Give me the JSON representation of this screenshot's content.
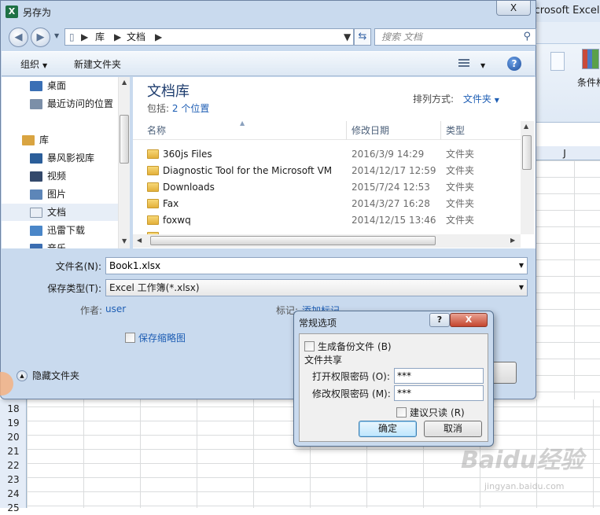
{
  "excel": {
    "title_fragment": "icrosoft Excel",
    "ribbon_label": "条件格",
    "column_header": "J",
    "row_numbers": [
      "18",
      "19",
      "20",
      "21",
      "22",
      "23",
      "24",
      "25"
    ]
  },
  "save_dialog": {
    "title": "另存为",
    "close_label": "X",
    "breadcrumb": [
      "库",
      "文档"
    ],
    "search_placeholder": "搜索 文档",
    "toolbar": {
      "organize": "组织",
      "new_folder": "新建文件夹"
    },
    "nav_items": [
      {
        "label": "桌面",
        "icon": "desktop-icon"
      },
      {
        "label": "最近访问的位置",
        "icon": "recent-places-icon"
      },
      {
        "label": "库",
        "icon": "libraries-icon"
      },
      {
        "label": "暴风影视库",
        "icon": "video-library-icon"
      },
      {
        "label": "视频",
        "icon": "video-icon"
      },
      {
        "label": "图片",
        "icon": "picture-icon"
      },
      {
        "label": "文档",
        "icon": "document-icon"
      },
      {
        "label": "迅雷下载",
        "icon": "download-icon"
      },
      {
        "label": "音乐",
        "icon": "music-icon"
      }
    ],
    "library": {
      "title": "文档库",
      "includes_prefix": "包括:",
      "includes_link": "2 个位置",
      "arrange_label": "排列方式:",
      "arrange_value": "文件夹"
    },
    "columns": {
      "name": "名称",
      "modified": "修改日期",
      "type": "类型"
    },
    "files": [
      {
        "name": "360js Files",
        "modified": "2016/3/9 14:29",
        "type": "文件夹"
      },
      {
        "name": "Diagnostic Tool for the Microsoft VM",
        "modified": "2014/12/17 12:59",
        "type": "文件夹"
      },
      {
        "name": "Downloads",
        "modified": "2015/7/24 12:53",
        "type": "文件夹"
      },
      {
        "name": "Fax",
        "modified": "2014/3/27 16:28",
        "type": "文件夹"
      },
      {
        "name": "foxwq",
        "modified": "2014/12/15 13:46",
        "type": "文件夹"
      }
    ],
    "form": {
      "filename_label": "文件名(N):",
      "filename_value": "Book1.xlsx",
      "filetype_label": "保存类型(T):",
      "filetype_value": "Excel 工作簿(*.xlsx)",
      "author_label": "作者:",
      "author_value": "user",
      "tags_label": "标记:",
      "tags_value": "添加标记",
      "thumbnail_label": "保存缩略图",
      "hide_folders": "隐藏文件夹"
    }
  },
  "options_dialog": {
    "title": "常规选项",
    "help_label": "?",
    "close_label": "X",
    "backup_label": "生成备份文件",
    "backup_key": "(B)",
    "sharing_label": "文件共享",
    "open_password_label": "打开权限密码",
    "open_password_key": "(O):",
    "open_password_value": "***",
    "modify_password_label": "修改权限密码",
    "modify_password_key": "(M):",
    "modify_password_value": "***",
    "readonly_label": "建议只读",
    "readonly_key": "(R)",
    "ok_label": "确定",
    "cancel_label": "取消"
  },
  "watermark": {
    "brand": "Baidu经验",
    "url": "jingyan.baidu.com"
  }
}
